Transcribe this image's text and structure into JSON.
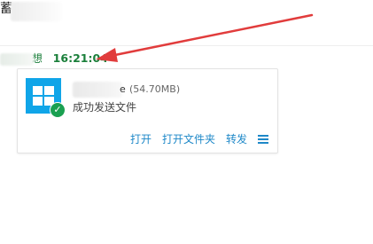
{
  "top": {
    "name_visible": "蓄"
  },
  "message": {
    "sender_visible": "想",
    "time": "16:21:04"
  },
  "file_card": {
    "icon": "windows-icon",
    "badge_icon": "check-icon",
    "name_visible": "e",
    "size": "(54.70MB)",
    "status": "成功发送文件",
    "actions": {
      "open": "打开",
      "open_folder": "打开文件夹",
      "forward": "转发"
    },
    "more_icon": "menu-icon"
  },
  "colors": {
    "time_green": "#1a7f3a",
    "link_blue": "#1e88c8",
    "windows_blue": "#10a5e8",
    "check_green": "#1aa051",
    "annotation_red": "#e13c3c"
  }
}
